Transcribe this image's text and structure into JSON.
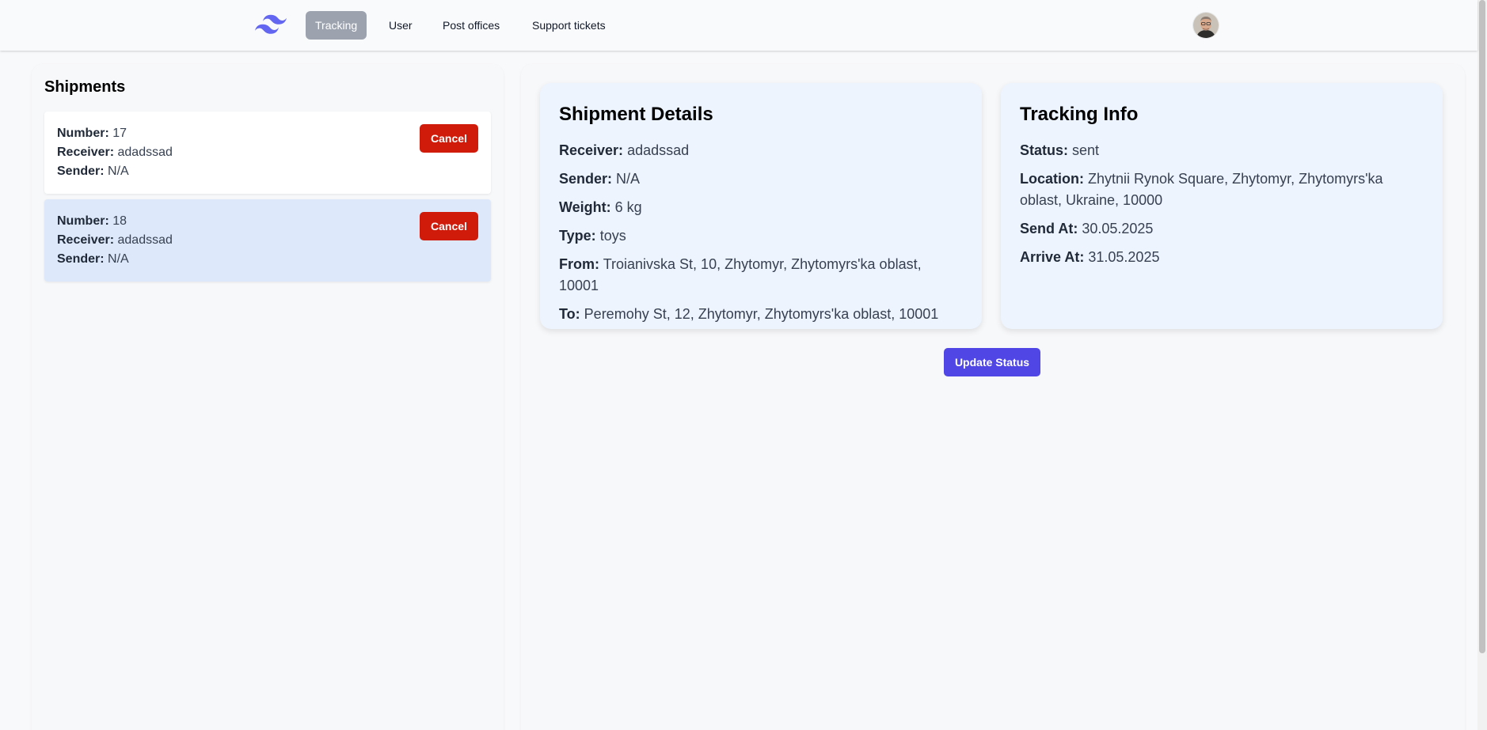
{
  "nav": {
    "logo": "tailwind-logo",
    "items": [
      {
        "label": "Tracking",
        "active": true
      },
      {
        "label": "User",
        "active": false
      },
      {
        "label": "Post offices",
        "active": false
      },
      {
        "label": "Support tickets",
        "active": false
      }
    ]
  },
  "shipments": {
    "title": "Shipments",
    "list": [
      {
        "number_label": "Number:",
        "number": "17",
        "receiver_label": "Receiver:",
        "receiver": "adadssad",
        "sender_label": "Sender:",
        "sender": "N/A",
        "cancel_label": "Cancel",
        "selected": false
      },
      {
        "number_label": "Number:",
        "number": "18",
        "receiver_label": "Receiver:",
        "receiver": "adadssad",
        "sender_label": "Sender:",
        "sender": "N/A",
        "cancel_label": "Cancel",
        "selected": true
      }
    ]
  },
  "details": {
    "title": "Shipment Details",
    "receiver_label": "Receiver:",
    "receiver": "adadssad",
    "sender_label": "Sender:",
    "sender": "N/A",
    "weight_label": "Weight:",
    "weight": "6 kg",
    "type_label": "Type:",
    "type": "toys",
    "from_label": "From:",
    "from": "Troianivska St, 10, Zhytomyr, Zhytomyrs'ka oblast, 10001",
    "to_label": "To:",
    "to": "Peremohy St, 12, Zhytomyr, Zhytomyrs'ka oblast, 10001"
  },
  "tracking": {
    "title": "Tracking Info",
    "status_label": "Status:",
    "status": "sent",
    "location_label": "Location:",
    "location": "Zhytnii Rynok Square, Zhytomyr, Zhytomyrs'ka oblast, Ukraine, 10000",
    "send_label": "Send At:",
    "send_at": "30.05.2025",
    "arrive_label": "Arrive At:",
    "arrive_at": "31.05.2025"
  },
  "actions": {
    "update_status_label": "Update Status"
  },
  "colors": {
    "accent": "#4f46e5",
    "danger": "#d01b0b",
    "nav_active": "#9ca3af",
    "selected_card": "#dde9fb",
    "info_card": "#edf4fe",
    "logo": "#6366f1"
  }
}
